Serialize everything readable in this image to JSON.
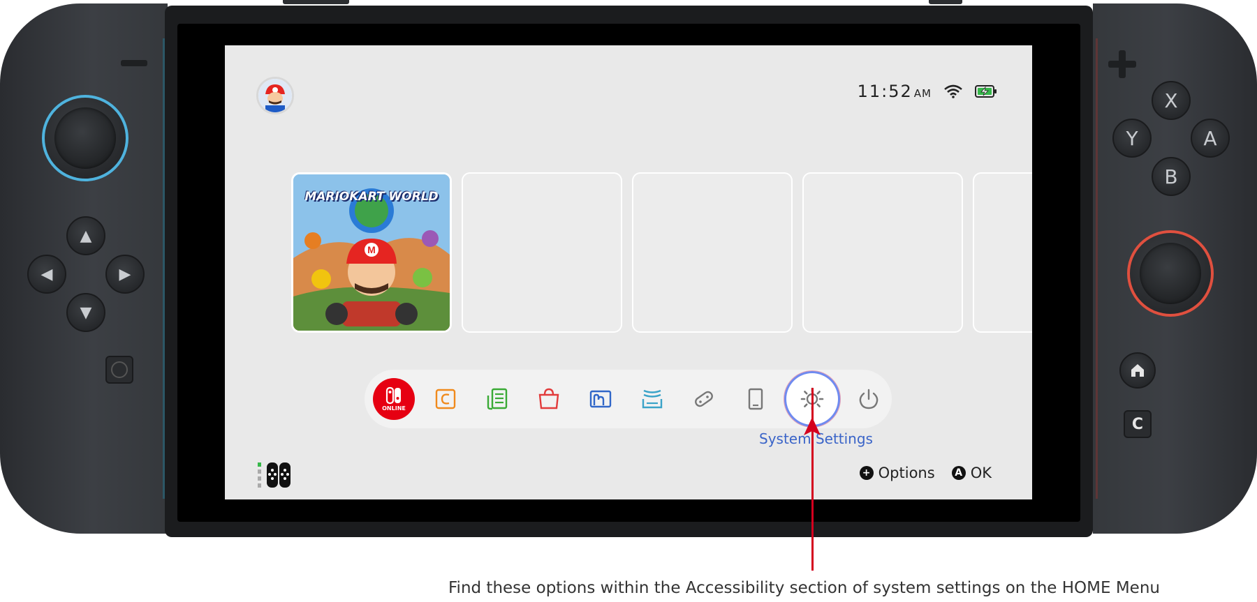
{
  "status_bar": {
    "time": "11:52",
    "meridiem": "AM",
    "wifi_icon": "wifi-icon",
    "battery_icon": "battery-charging-icon"
  },
  "user": {
    "avatar_icon": "mario-avatar-icon"
  },
  "tiles": [
    {
      "title_art": "MARIOKART WORLD",
      "type": "game"
    },
    {
      "type": "empty"
    },
    {
      "type": "empty"
    },
    {
      "type": "empty"
    },
    {
      "type": "empty"
    }
  ],
  "dock": {
    "online_label": "ONLINE",
    "items": [
      {
        "icon": "nintendo-switch-online-icon",
        "color": "#e60012"
      },
      {
        "icon": "gamechat-icon",
        "color": "#f08a1c"
      },
      {
        "icon": "news-icon",
        "color": "#3aaa35"
      },
      {
        "icon": "eshop-icon",
        "color": "#e23b3b"
      },
      {
        "icon": "album-icon",
        "color": "#3066c8"
      },
      {
        "icon": "game-cards-icon",
        "color": "#3aa3c8"
      },
      {
        "icon": "controllers-icon",
        "color": "#777777"
      },
      {
        "icon": "virtual-game-cards-icon",
        "color": "#777777"
      },
      {
        "icon": "system-settings-icon",
        "color": "#777777"
      },
      {
        "icon": "power-icon",
        "color": "#777777"
      }
    ],
    "selected_label": "System Settings"
  },
  "footer": {
    "options_icon": "+",
    "options_label": "Options",
    "ok_icon": "A",
    "ok_label": "OK"
  },
  "controller": {
    "buttons": {
      "x": "X",
      "y": "Y",
      "a": "A",
      "b": "B",
      "capture": "C"
    }
  },
  "annotation": {
    "caption": "Find these options within the Accessibility section of system settings on the HOME Menu",
    "arrow_color": "#d4001e"
  }
}
